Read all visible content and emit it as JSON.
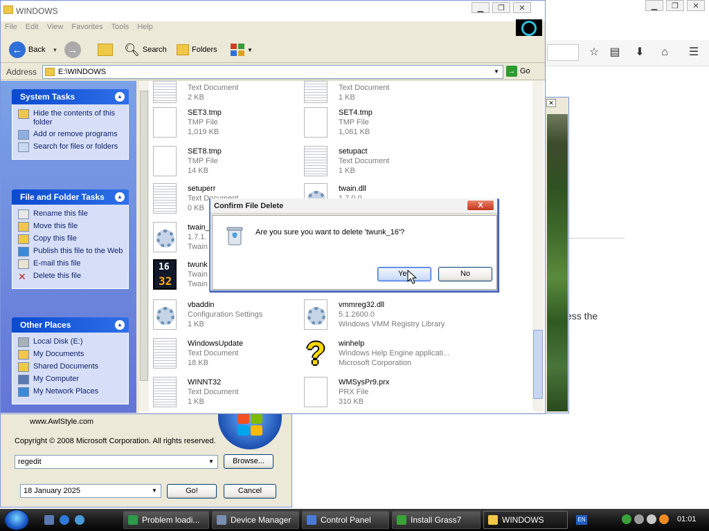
{
  "explorer": {
    "title": "WINDOWS",
    "menu": [
      "File",
      "Edit",
      "View",
      "Favorites",
      "Tools",
      "Help"
    ],
    "toolbar": {
      "back": "Back",
      "search": "Search",
      "folders": "Folders"
    },
    "address": {
      "label": "Address",
      "value": "E:\\WINDOWS",
      "go": "Go"
    },
    "panels": [
      {
        "title": "System Tasks",
        "items": [
          {
            "label": "Hide the contents of this folder",
            "icon": "folder-icon"
          },
          {
            "label": "Add or remove programs",
            "icon": "programs-icon"
          },
          {
            "label": "Search for files or folders",
            "icon": "search-icon"
          }
        ]
      },
      {
        "title": "File and Folder Tasks",
        "items": [
          {
            "label": "Rename this file",
            "icon": "rename-icon"
          },
          {
            "label": "Move this file",
            "icon": "move-icon"
          },
          {
            "label": "Copy this file",
            "icon": "copy-icon"
          },
          {
            "label": "Publish this file to the Web",
            "icon": "web-icon"
          },
          {
            "label": "E-mail this file",
            "icon": "email-icon"
          },
          {
            "label": "Delete this file",
            "icon": "delete-icon"
          }
        ]
      },
      {
        "title": "Other Places",
        "items": [
          {
            "label": "Local Disk (E:)",
            "icon": "disk-icon"
          },
          {
            "label": "My Documents",
            "icon": "documents-icon"
          },
          {
            "label": "Shared Documents",
            "icon": "folder-icon"
          },
          {
            "label": "My Computer",
            "icon": "computer-icon"
          },
          {
            "label": "My Network Places",
            "icon": "network-icon"
          }
        ]
      }
    ],
    "files": [
      {
        "name": "",
        "type": "Text Document",
        "size": "2 KB",
        "icon": "text"
      },
      {
        "name": "",
        "type": "Text Document",
        "size": "1 KB",
        "icon": "text"
      },
      {
        "name": "SET3.tmp",
        "type": "TMP File",
        "size": "1,019 KB",
        "icon": "blank"
      },
      {
        "name": "SET4.tmp",
        "type": "TMP File",
        "size": "1,061 KB",
        "icon": "blank"
      },
      {
        "name": "SET8.tmp",
        "type": "TMP File",
        "size": "14 KB",
        "icon": "blank"
      },
      {
        "name": "setupact",
        "type": "Text Document",
        "size": "1 KB",
        "icon": "text"
      },
      {
        "name": "setuperr",
        "type": "Text Document",
        "size": "0 KB",
        "icon": "text"
      },
      {
        "name": "twain.dll",
        "type": "1.7.0.0",
        "size": "",
        "icon": "gear"
      },
      {
        "name": "twain_",
        "type": "1.7.1.",
        "size": "Twain",
        "icon": "gear"
      },
      {
        "name": "",
        "type": "",
        "size": "",
        "icon": "none"
      },
      {
        "name": "twunk",
        "type": "Twain",
        "size": "Twain",
        "icon": "twunk"
      },
      {
        "name": "",
        "type": "",
        "size": "",
        "icon": "none"
      },
      {
        "name": "vbaddin",
        "type": "Configuration Settings",
        "size": "1 KB",
        "icon": "gear"
      },
      {
        "name": "vmmreg32.dll",
        "type": "5.1.2600.0",
        "size": "Windows VMM Registry Library",
        "icon": "gear"
      },
      {
        "name": "WindowsUpdate",
        "type": "Text Document",
        "size": "18 KB",
        "icon": "text"
      },
      {
        "name": "winhelp",
        "type": "Windows Help Engine applicati...",
        "size": "Microsoft Corporation",
        "icon": "help"
      },
      {
        "name": "WINNT32",
        "type": "Text Document",
        "size": "1 KB",
        "icon": "text"
      },
      {
        "name": "WMSysPr9.prx",
        "type": "PRX File",
        "size": "310 KB",
        "icon": "blank"
      }
    ]
  },
  "dialog": {
    "title": "Confirm File Delete",
    "close": "X",
    "message": "Are you sure you want to delete 'twunk_16'?",
    "yes": "Yes",
    "no": "No"
  },
  "run_dialog": {
    "website": "www.AwlStyle.com",
    "copyright": "Copyright © 2008 Microsoft Corporation. All rights reserved.",
    "command": "regedit",
    "browse": "Browse...",
    "date": "18  January   2025",
    "go": "Go!",
    "cancel": "Cancel"
  },
  "browser": {
    "text": "ess the"
  },
  "taskbar": {
    "items": [
      {
        "label": "Problem loadi...",
        "color": "#2e9a4a"
      },
      {
        "label": "Device Manager",
        "color": "#7a8fb0"
      },
      {
        "label": "Control Panel",
        "color": "#4a7ad6"
      },
      {
        "label": "Install Grass7",
        "color": "#3aa03a"
      },
      {
        "label": "WINDOWS",
        "color": "#f0c848"
      }
    ],
    "lang": "EN",
    "clock": "01:01"
  }
}
